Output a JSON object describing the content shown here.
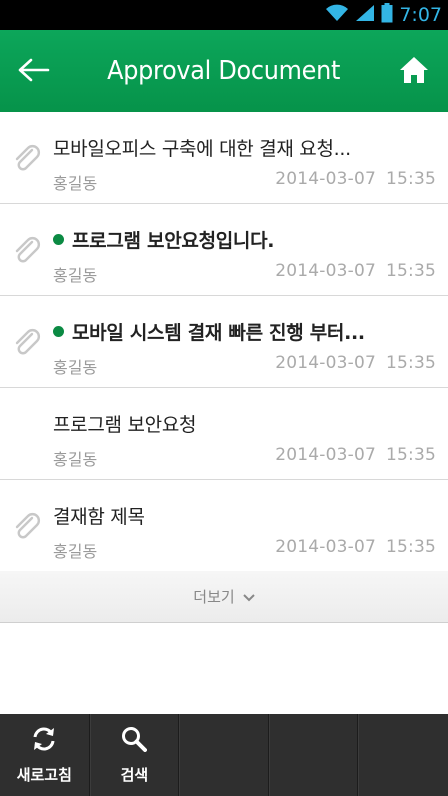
{
  "status_bar": {
    "time": "7:07"
  },
  "header": {
    "title": "Approval Document",
    "back_icon": "back-arrow-icon",
    "home_icon": "home-icon"
  },
  "documents": [
    {
      "subject": "모바일오피스 구축에 대한 결재 요청...",
      "author": "홍길동",
      "date": "2014-03-07",
      "time": "15:35",
      "attachment": true,
      "unread": false
    },
    {
      "subject": "프로그램 보안요청입니다.",
      "author": "홍길동",
      "date": "2014-03-07",
      "time": "15:35",
      "attachment": true,
      "unread": true
    },
    {
      "subject": "모바일 시스템 결재 빠른 진행 부터...",
      "author": "홍길동",
      "date": "2014-03-07",
      "time": "15:35",
      "attachment": true,
      "unread": true
    },
    {
      "subject": "프로그램 보안요청",
      "author": "홍길동",
      "date": "2014-03-07",
      "time": "15:35",
      "attachment": false,
      "unread": false
    },
    {
      "subject": "결재함 제목",
      "author": "홍길동",
      "date": "2014-03-07",
      "time": "15:35",
      "attachment": true,
      "unread": false
    }
  ],
  "more": {
    "label": "더보기"
  },
  "toolbar": {
    "refresh_label": "새로고침",
    "search_label": "검색"
  },
  "colors": {
    "header_green": "#0ca65a",
    "unread_dot": "#0b8a43",
    "toolbar_bg": "#2f2f2f",
    "status_time": "#33b5e5"
  }
}
